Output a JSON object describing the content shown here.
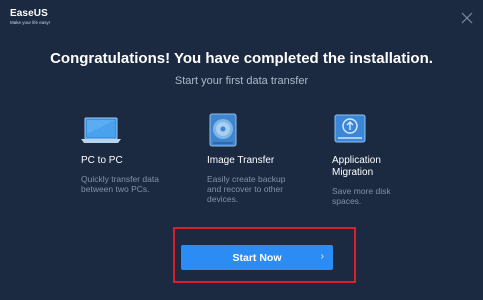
{
  "logo": {
    "name": "EaseUS",
    "tagline": "Make your life easy!"
  },
  "header": {
    "title": "Congratulations! You have completed the installation.",
    "subtitle": "Start your first data transfer"
  },
  "features": [
    {
      "icon": "laptop-icon",
      "title": "PC to PC",
      "desc": "Quickly transfer data between two PCs."
    },
    {
      "icon": "disk-image-icon",
      "title": "Image Transfer",
      "desc": "Easily create backup and recover to other devices."
    },
    {
      "icon": "app-upload-drive-icon",
      "title": "Application Migration",
      "desc": "Save more disk spaces."
    }
  ],
  "actions": {
    "start_label": "Start Now",
    "chevron": "›"
  },
  "colors": {
    "background": "#1b2a41",
    "accent": "#2b8cf3",
    "highlight": "#d9202a"
  }
}
